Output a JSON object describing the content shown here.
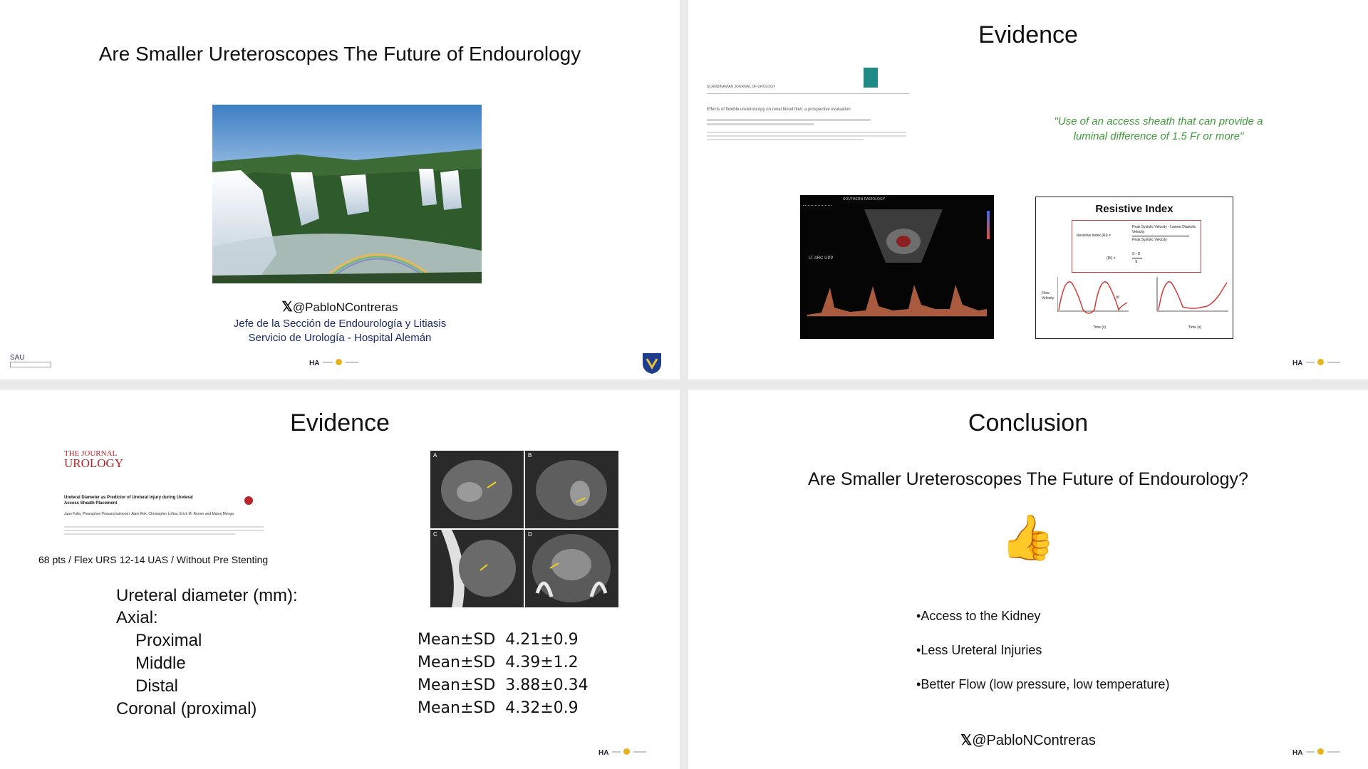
{
  "slide1": {
    "title": "Are Smaller Ureteroscopes The Future of Endourology",
    "handle": "@PabloNContreras",
    "role": "Jefe de la Sección de Endourología y Litiasis",
    "service": "Servicio de Urología - Hospital Alemán",
    "sau_logo": "SAU",
    "footer_logo": "HA"
  },
  "slide2": {
    "title": "Evidence",
    "quote": "\"Use of an access sheath that can provide a luminal difference of 1.5 Fr or more\"",
    "article_title": "Effects of flexible ureteroscopy on renal blood flow: a prospective evaluation",
    "article_journal": "SCANDINAVIAN JOURNAL OF UROLOGY",
    "ultrasound_header": "SOUTHERN RADIOLOGY",
    "ultrasound_label": "LT ARC UPP",
    "ri_title": "Resistive Index",
    "ri_formula_label": "Resistive Index (RI) =",
    "ri_numerator": "Peak Systolic Velocity - Lowest Diastolic Velocity",
    "ri_denominator": "Peak Systolic Velocity",
    "ri_ri": "(RI) =",
    "ri_sd": "S - D",
    "ri_s": "S",
    "ri_flow": "Flow Velocity",
    "ri_or": "or",
    "ri_time": "Time (s)",
    "footer_logo": "HA"
  },
  "slide3": {
    "title": "Evidence",
    "journal_top": "THE JOURNAL",
    "journal_bottom": "UROLOGY",
    "article_title": "Ureteral Diameter as Predictor of Ureteral Injury during Ureteral Access Sheath Placement",
    "authors": "Juan Fulla, Phanuphon Prasanchaimontri, Alain Rok, Christopher Loftus, Erick M. Remer and Manoj Monga",
    "study_line": "68 pts / Flex URS 12-14 UAS /  Without Pre Stenting",
    "ct_labels": [
      "A",
      "B",
      "C",
      "D"
    ],
    "measure_header": "Ureteral diameter (mm):",
    "axial_label": "Axial:",
    "rows": [
      {
        "label": "Proximal",
        "value": "Mean±SD  4.21±0.9"
      },
      {
        "label": "Middle",
        "value": "Mean±SD  4.39±1.2"
      },
      {
        "label": "Distal",
        "value": "Mean±SD  3.88±0.34"
      },
      {
        "label": "Coronal (proximal)",
        "value": "Mean±SD  4.32±0.9"
      }
    ],
    "footer_logo": "HA"
  },
  "slide4": {
    "title": "Conclusion",
    "question": "Are Smaller Ureteroscopes The Future of Endourology?",
    "thumbs": "👍",
    "bullets": [
      "Access to the Kidney",
      "Less Ureteral Injuries",
      "Better Flow (low pressure, low temperature)"
    ],
    "handle": "@PabloNContreras",
    "footer_logo": "HA"
  },
  "colors": {
    "quote_green": "#3f9a3a",
    "journal_red": "#b8242a",
    "ri_box_red": "#d23b3b",
    "background": "#e9e9ea"
  }
}
